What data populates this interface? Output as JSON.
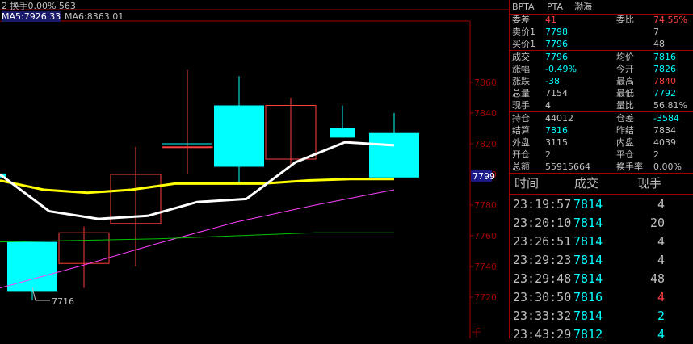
{
  "header": {
    "line1": "2 换手0.00% 563",
    "ma5_label": "MA5:7926.33",
    "ma6_label": "MA6:8363.01"
  },
  "chart_data": {
    "type": "candlestick",
    "ylim": [
      7700,
      7900
    ],
    "y_ticks": [
      "7860",
      "7840",
      "7820",
      "7800",
      "7780",
      "7760",
      "7740",
      "7720"
    ],
    "current_price_label": "7799",
    "low_label": "7716",
    "bottom_unit": "千",
    "candles": [
      {
        "open": 7724,
        "close": 7756,
        "high": 7756,
        "low": 7718,
        "up": false
      },
      {
        "open": 7742,
        "close": 7762,
        "high": 7766,
        "low": 7726,
        "up": true
      },
      {
        "open": 7768,
        "close": 7800,
        "high": 7818,
        "low": 7740,
        "up": true
      },
      {
        "open": 7818,
        "close": 7818,
        "high": 7868,
        "low": 7800,
        "up": true
      },
      {
        "open": 7805,
        "close": 7845,
        "high": 7864,
        "low": 7794,
        "up": false
      },
      {
        "open": 7810,
        "close": 7845,
        "high": 7850,
        "low": 7805,
        "up": true
      },
      {
        "open": 7824,
        "close": 7830,
        "high": 7845,
        "low": 7824,
        "up": false
      },
      {
        "open": 7798,
        "close": 7827,
        "high": 7840,
        "low": 7798,
        "up": false
      }
    ],
    "series": [
      {
        "color": "#ffff00",
        "values": [
          7796,
          7790,
          7788,
          7790,
          7794,
          7794,
          7794,
          7796,
          7797,
          7797
        ]
      },
      {
        "color": "#ffffff",
        "values": [
          7800,
          7776,
          7771,
          7773,
          7782,
          7784,
          7808,
          7821,
          7819
        ]
      },
      {
        "color": "#ff40ff",
        "values": [
          7726,
          7740,
          7755,
          7769,
          7780,
          7790
        ]
      },
      {
        "color": "#00c000",
        "values": [
          7756,
          7757,
          7758,
          7760,
          7762,
          7762
        ]
      }
    ]
  },
  "quote": {
    "code": "BPTA",
    "name1": "PTA",
    "name2": "渤海",
    "rows": [
      {
        "l1": "委差",
        "v1": "41",
        "c1": "#ff4040",
        "l2": "委比",
        "v2": "74.55%",
        "c2": "#ff4040"
      },
      {
        "l1": "卖价1",
        "v1": "7798",
        "c1": "#00ffff",
        "l2": "",
        "v2": "7",
        "c2": "#c0c0c0"
      },
      {
        "l1": "买价1",
        "v1": "7796",
        "c1": "#00ffff",
        "l2": "",
        "v2": "48",
        "c2": "#c0c0c0"
      },
      {
        "l1": "成交",
        "v1": "7796",
        "c1": "#00ffff",
        "l2": "均价",
        "v2": "7816",
        "c2": "#00ffff"
      },
      {
        "l1": "涨幅",
        "v1": "-0.49%",
        "c1": "#00ffff",
        "l2": "今开",
        "v2": "7826",
        "c2": "#00ffff"
      },
      {
        "l1": "涨跌",
        "v1": "-38",
        "c1": "#00ffff",
        "l2": "最高",
        "v2": "7840",
        "c2": "#ff4040"
      },
      {
        "l1": "总量",
        "v1": "7154",
        "c1": "#c0c0c0",
        "l2": "最低",
        "v2": "7792",
        "c2": "#00ffff"
      },
      {
        "l1": "现手",
        "v1": "4",
        "c1": "#c0c0c0",
        "l2": "量比",
        "v2": "56.81%",
        "c2": "#c0c0c0"
      },
      {
        "l1": "持仓",
        "v1": "44012",
        "c1": "#c0c0c0",
        "l2": "仓差",
        "v2": "-3584",
        "c2": "#00ffff"
      },
      {
        "l1": "结算",
        "v1": "7816",
        "c1": "#00ffff",
        "l2": "昨结",
        "v2": "7834",
        "c2": "#c0c0c0"
      },
      {
        "l1": "外盘",
        "v1": "3115",
        "c1": "#c0c0c0",
        "l2": "内盘",
        "v2": "4039",
        "c2": "#c0c0c0"
      },
      {
        "l1": "开仓",
        "v1": "2",
        "c1": "#c0c0c0",
        "l2": "平仓",
        "v2": "2",
        "c2": "#c0c0c0"
      },
      {
        "l1": "总额",
        "v1": "55915664",
        "c1": "#c0c0c0",
        "l2": "换手率",
        "v2": "0.00%",
        "c2": "#c0c0c0"
      }
    ]
  },
  "trades": {
    "headers": {
      "time": "时间",
      "price": "成交",
      "vol": "现手"
    },
    "rows": [
      {
        "time": "23:19:57",
        "price": "7814",
        "vol": "4",
        "vc": "#c0c0c0"
      },
      {
        "time": "23:20:10",
        "price": "7814",
        "vol": "20",
        "vc": "#c0c0c0"
      },
      {
        "time": "23:26:51",
        "price": "7814",
        "vol": "4",
        "vc": "#c0c0c0"
      },
      {
        "time": "23:29:23",
        "price": "7814",
        "vol": "4",
        "vc": "#c0c0c0"
      },
      {
        "time": "23:29:48",
        "price": "7814",
        "vol": "48",
        "vc": "#c0c0c0"
      },
      {
        "time": "23:30:50",
        "price": "7816",
        "vol": "4",
        "vc": "#ff4040"
      },
      {
        "time": "23:33:32",
        "price": "7814",
        "vol": "2",
        "vc": "#00ffff"
      },
      {
        "time": "23:43:29",
        "price": "7812",
        "vol": "4",
        "vc": "#00ffff"
      }
    ]
  }
}
